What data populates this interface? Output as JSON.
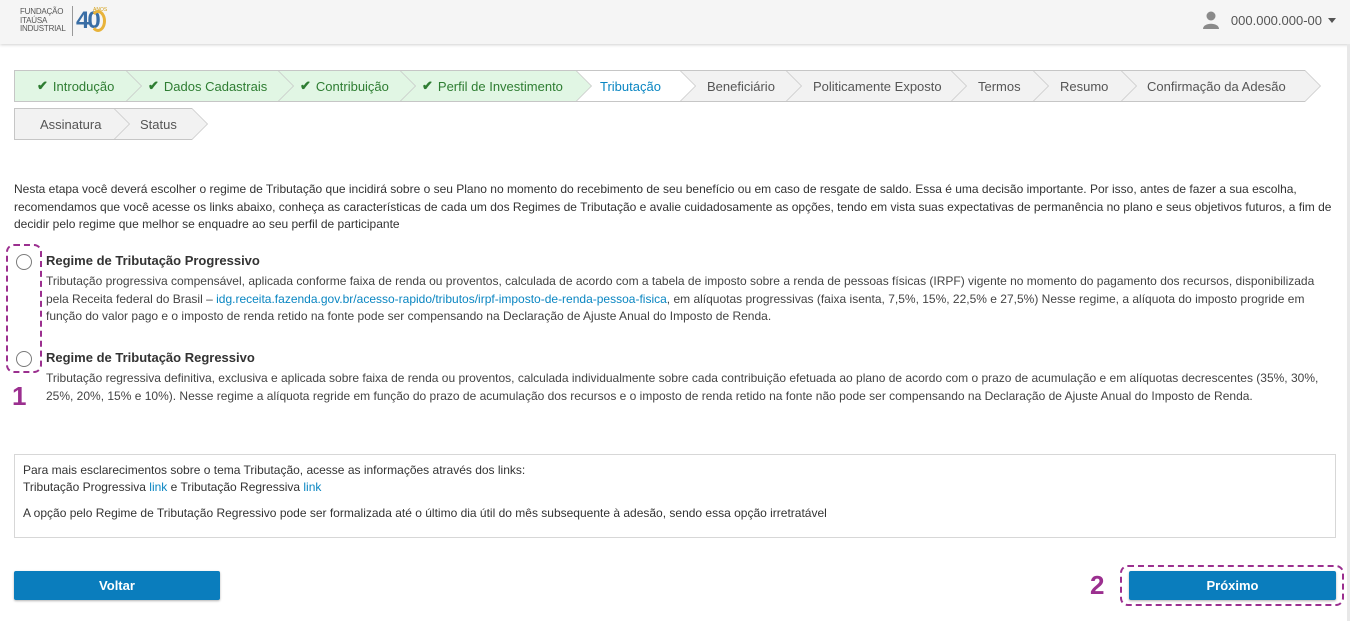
{
  "header": {
    "logo_text": [
      "FUNDAÇÃO",
      "ITAÚSA",
      "INDUSTRIAL"
    ],
    "logo_badge_small": "ANOS",
    "logo_badge": "40",
    "user_id": "000.000.000-00",
    "user_icon": "user-icon",
    "dropdown_icon": "caret-down-icon"
  },
  "steps": [
    {
      "label": "Introdução",
      "status": "done"
    },
    {
      "label": "Dados Cadastrais",
      "status": "done"
    },
    {
      "label": "Contribuição",
      "status": "done"
    },
    {
      "label": "Perfil de Investimento",
      "status": "done"
    },
    {
      "label": "Tributação",
      "status": "current"
    },
    {
      "label": "Beneficiário",
      "status": "pending"
    },
    {
      "label": "Politicamente Exposto",
      "status": "pending"
    },
    {
      "label": "Termos",
      "status": "pending"
    },
    {
      "label": "Resumo",
      "status": "pending"
    },
    {
      "label": "Confirmação da Adesão",
      "status": "pending"
    },
    {
      "label": "Assinatura",
      "status": "pending"
    },
    {
      "label": "Status",
      "status": "pending"
    }
  ],
  "intro": "Nesta etapa você deverá escolher o regime de Tributação que incidirá sobre o seu Plano no momento do recebimento de seu benefício ou em caso de resgate de saldo. Essa é uma decisão importante. Por isso, antes de fazer a sua escolha, recomendamos que você acesse os links abaixo, conheça as características de cada um dos Regimes de Tributação e avalie cuidadosamente as opções, tendo em vista suas expectativas de permanência no plano e seus objetivos futuros, a fim de decidir pelo regime que melhor se enquadre ao seu perfil de participante",
  "options": {
    "progressive": {
      "title": "Regime de Tributação Progressivo",
      "desc_before": "Tributação progressiva compensável, aplicada conforme faixa de renda ou proventos, calculada de acordo com a tabela de imposto sobre a renda de pessoas físicas (IRPF) vigente no momento do pagamento dos recursos, disponibilizada pela Receita federal do Brasil – ",
      "link": "idg.receita.fazenda.gov.br/acesso-rapido/tributos/irpf-imposto-de-renda-pessoa-fisica",
      "desc_after": ", em alíquotas progressivas (faixa isenta, 7,5%, 15%, 22,5% e 27,5%) Nesse regime, a alíquota do imposto progride em função do valor pago e o imposto de renda retido na fonte pode ser compensando na Declaração de Ajuste Anual do Imposto de Renda."
    },
    "regressive": {
      "title": "Regime de Tributação Regressivo",
      "desc": "Tributação regressiva definitiva, exclusiva e aplicada sobre faixa de renda ou proventos, calculada individualmente sobre cada contribuição efetuada ao plano de acordo com o prazo de acumulação e em alíquotas decrescentes (35%, 30%, 25%, 20%, 15% e 10%). Nesse regime a alíquota regride em função do prazo de acumulação dos recursos e o imposto de renda retido na fonte não pode ser compensando na Declaração de Ajuste Anual do Imposto de Renda."
    }
  },
  "info": {
    "line1": "Para mais esclarecimentos sobre o tema Tributação, acesse as informações através dos links:",
    "prog_label": "Tributação Progressiva",
    "link_label": "link",
    "and_regressive": " e Tributação Regressiva ",
    "note": "A opção pelo Regime de Tributação Regressivo pode ser formalizada até o último dia útil do mês subsequente à adesão, sendo essa opção irretratável"
  },
  "buttons": {
    "back": "Voltar",
    "next": "Próximo"
  },
  "annotations": {
    "one": "1",
    "two": "2"
  },
  "colors": {
    "accent": "#0a7dbd",
    "done_bg": "#e1f6e4",
    "done_text": "#2e7d32",
    "annotation": "#9b2f8f"
  }
}
